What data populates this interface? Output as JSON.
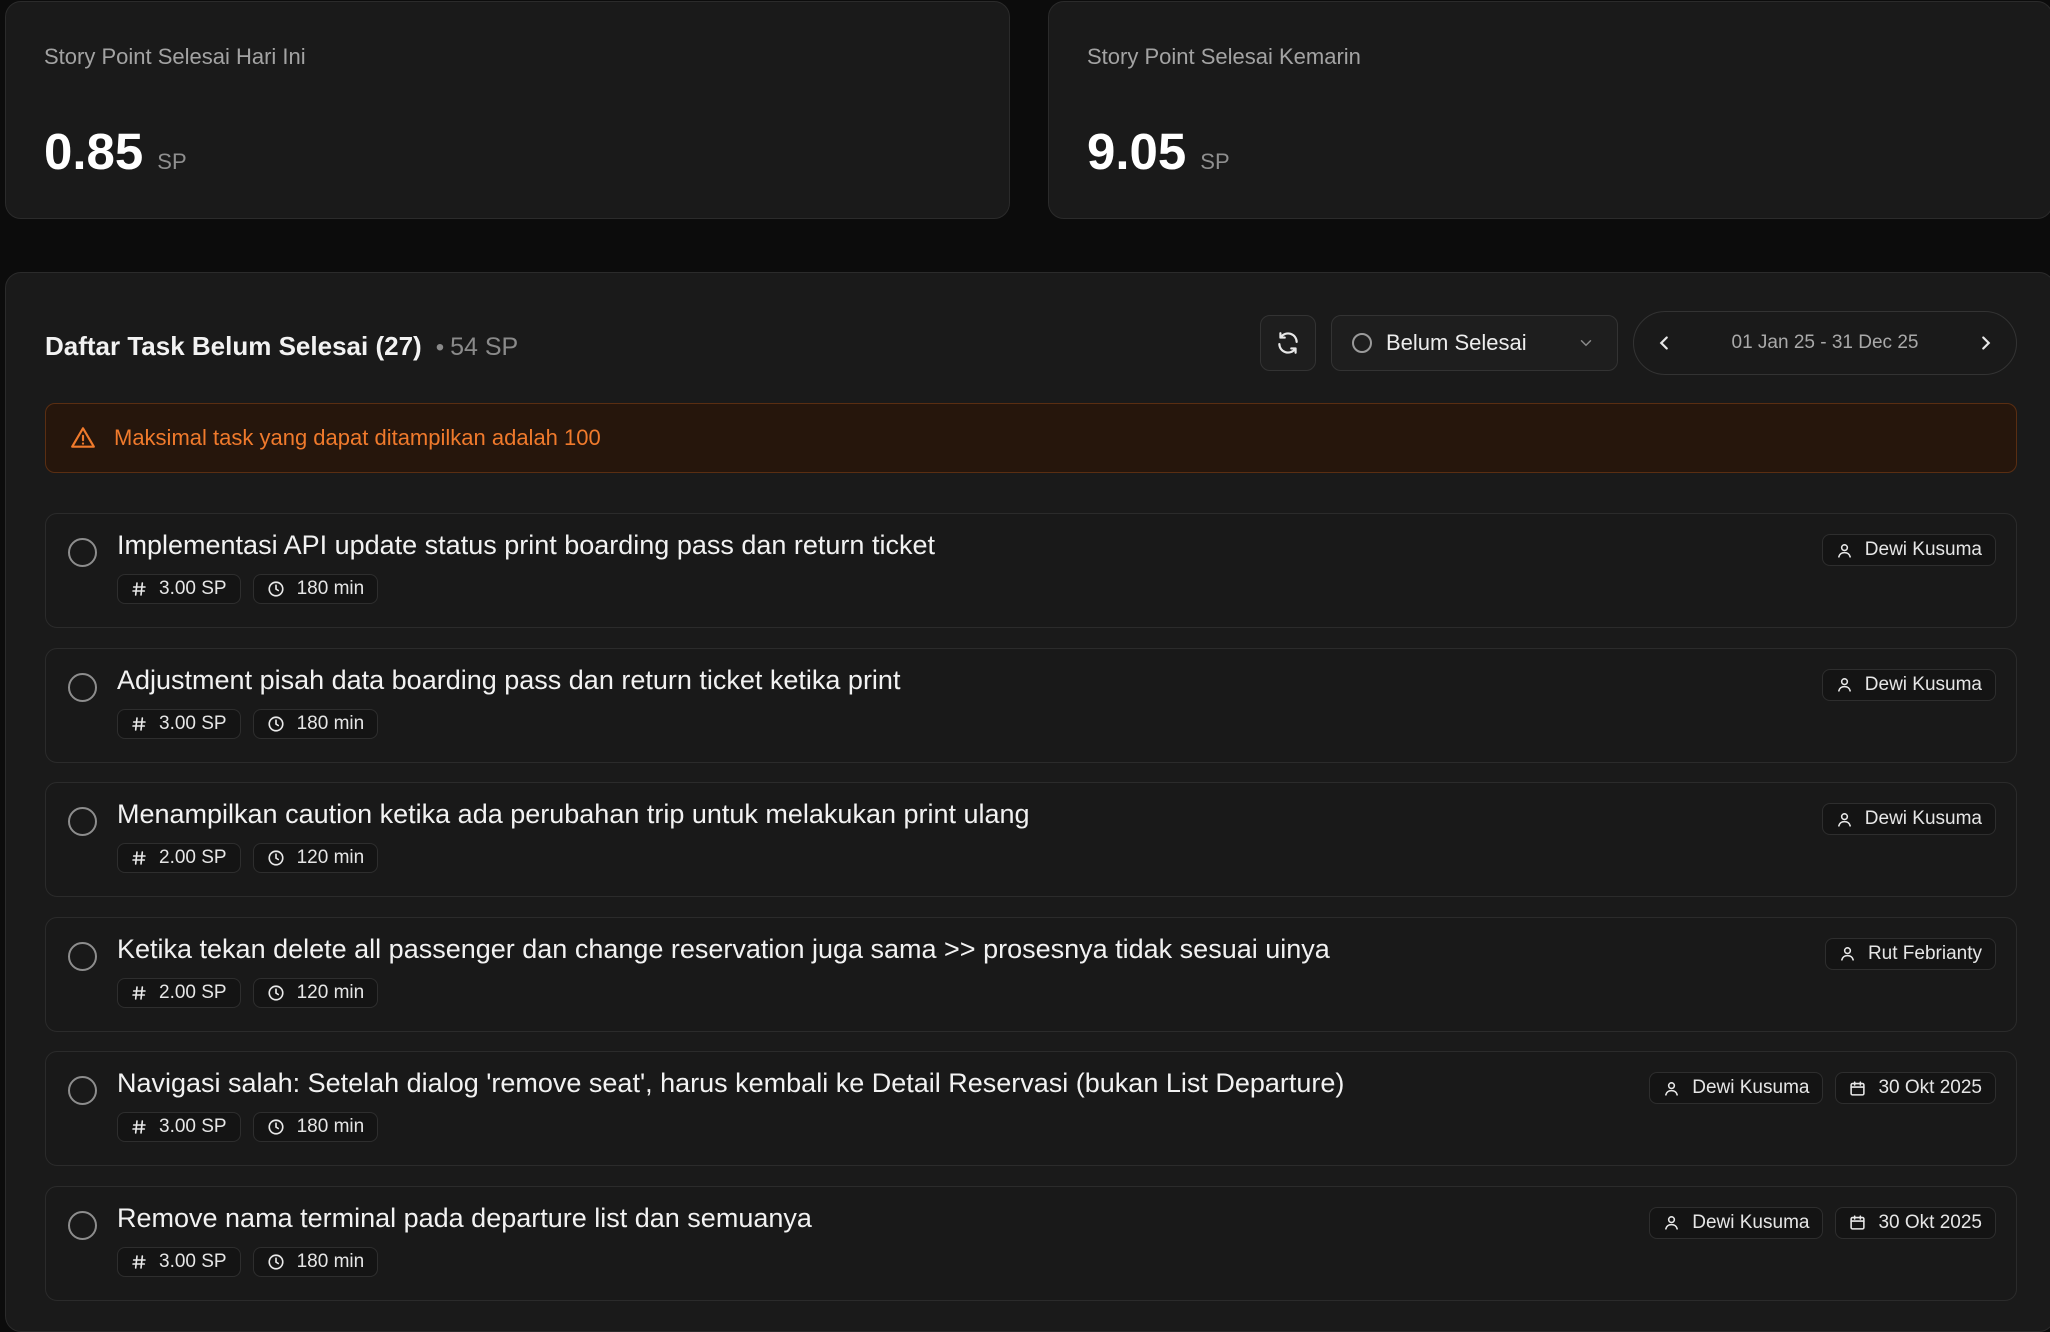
{
  "stats": [
    {
      "label": "Story Point Selesai Hari Ini",
      "value": "0.85",
      "unit": "SP"
    },
    {
      "label": "Story Point Selesai Kemarin",
      "value": "9.05",
      "unit": "SP"
    }
  ],
  "panel": {
    "title": "Daftar Task Belum Selesai (27)",
    "separator": "•",
    "total_sp": "54 SP",
    "status_filter": "Belum Selesai",
    "date_range": "01 Jan 25 - 31 Dec 25",
    "warning": "Maksimal task yang dapat ditampilkan adalah 100"
  },
  "tasks": [
    {
      "title": "Implementasi API update status print boarding pass dan return ticket",
      "sp": "3.00 SP",
      "duration": "180 min",
      "assignee": "Dewi Kusuma",
      "due": ""
    },
    {
      "title": "Adjustment pisah data boarding pass dan return ticket ketika print",
      "sp": "3.00 SP",
      "duration": "180 min",
      "assignee": "Dewi Kusuma",
      "due": ""
    },
    {
      "title": "Menampilkan caution ketika ada perubahan trip untuk melakukan print ulang",
      "sp": "2.00 SP",
      "duration": "120 min",
      "assignee": "Dewi Kusuma",
      "due": ""
    },
    {
      "title": "Ketika tekan delete all passenger dan change reservation juga sama >> prosesnya tidak sesuai uinya",
      "sp": "2.00 SP",
      "duration": "120 min",
      "assignee": "Rut Febrianty",
      "due": ""
    },
    {
      "title": "Navigasi salah: Setelah dialog 'remove seat', harus kembali ke Detail Reservasi (bukan List Departure)",
      "sp": "3.00 SP",
      "duration": "180 min",
      "assignee": "Dewi Kusuma",
      "due": "30 Okt 2025"
    },
    {
      "title": "Remove nama terminal pada departure list dan semuanya",
      "sp": "3.00 SP",
      "duration": "180 min",
      "assignee": "Dewi Kusuma",
      "due": "30 Okt 2025"
    }
  ]
}
